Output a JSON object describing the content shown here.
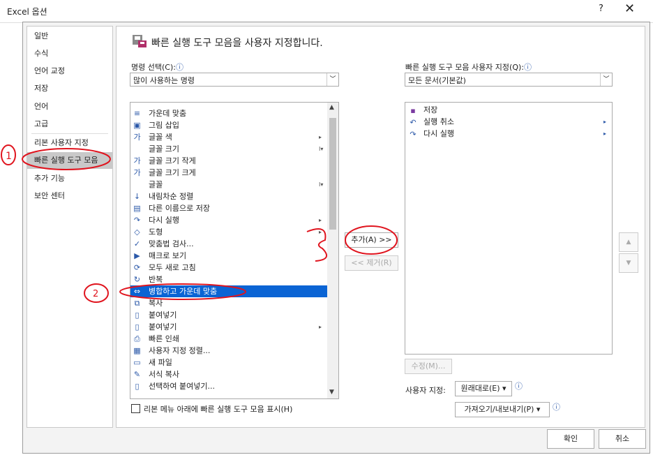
{
  "window": {
    "title": "Excel 옵션",
    "help": "?",
    "close": "✕"
  },
  "nav": {
    "items": [
      "일반",
      "수식",
      "언어 교정",
      "저장",
      "언어",
      "고급",
      "리본 사용자 지정",
      "빠른 실행 도구 모음",
      "추가 기능",
      "보안 센터"
    ],
    "selected_index": 7
  },
  "main": {
    "headline": "빠른 실행 도구 모음을 사용자 지정합니다.",
    "choose_label": "명령 선택(C):",
    "choose_value": "많이 사용하는 명령",
    "customize_label": "빠른 실행 도구 모음 사용자 지정(Q):",
    "customize_value": "모든 문서(기본값)",
    "info_icon": "ⓘ",
    "commands": [
      {
        "label": "가운데 맞춤",
        "icon": "align-center-icon",
        "glyph": "≡",
        "sub": ""
      },
      {
        "label": "그림 삽입",
        "icon": "picture-icon",
        "glyph": "▣",
        "sub": ""
      },
      {
        "label": "글꼴 색",
        "icon": "font-color-icon",
        "glyph": "가",
        "sub": "▸"
      },
      {
        "label": "글꼴 크기",
        "icon": "font-size-icon",
        "glyph": "",
        "sub": "I▾"
      },
      {
        "label": "글꼴 크기 작게",
        "icon": "font-shrink-icon",
        "glyph": "가",
        "sub": ""
      },
      {
        "label": "글꼴 크기 크게",
        "icon": "font-grow-icon",
        "glyph": "가",
        "sub": ""
      },
      {
        "label": "글꼴",
        "icon": "font-icon",
        "glyph": "",
        "sub": "I▾"
      },
      {
        "label": "내림차순 정렬",
        "icon": "sort-desc-icon",
        "glyph": "↓",
        "sub": ""
      },
      {
        "label": "다른 이름으로 저장",
        "icon": "save-as-icon",
        "glyph": "▤",
        "sub": ""
      },
      {
        "label": "다시 실행",
        "icon": "redo-icon",
        "glyph": "↷",
        "sub": "▸"
      },
      {
        "label": "도형",
        "icon": "shapes-icon",
        "glyph": "◇",
        "sub": "▸"
      },
      {
        "label": "맞춤법 검사...",
        "icon": "spellcheck-icon",
        "glyph": "✓",
        "sub": ""
      },
      {
        "label": "매크로 보기",
        "icon": "macro-icon",
        "glyph": "▶",
        "sub": ""
      },
      {
        "label": "모두 새로 고침",
        "icon": "refresh-all-icon",
        "glyph": "⟳",
        "sub": ""
      },
      {
        "label": "반복",
        "icon": "repeat-icon",
        "glyph": "↻",
        "sub": ""
      },
      {
        "label": "병합하고 가운데 맞춤",
        "icon": "merge-center-icon",
        "glyph": "⇔",
        "sub": ""
      },
      {
        "label": "복사",
        "icon": "copy-icon",
        "glyph": "⧉",
        "sub": ""
      },
      {
        "label": "붙여넣기",
        "icon": "paste-icon",
        "glyph": "▯",
        "sub": ""
      },
      {
        "label": "붙여넣기",
        "icon": "paste-icon",
        "glyph": "▯",
        "sub": "▸"
      },
      {
        "label": "빠른 인쇄",
        "icon": "quick-print-icon",
        "glyph": "⎙",
        "sub": ""
      },
      {
        "label": "사용자 지정 정렬...",
        "icon": "custom-sort-icon",
        "glyph": "▦",
        "sub": ""
      },
      {
        "label": "새 파일",
        "icon": "new-file-icon",
        "glyph": "▭",
        "sub": ""
      },
      {
        "label": "서식 복사",
        "icon": "format-painter-icon",
        "glyph": "✎",
        "sub": ""
      },
      {
        "label": "선택하여 붙여넣기...",
        "icon": "paste-special-icon",
        "glyph": "▯",
        "sub": ""
      }
    ],
    "selected_command_index": 15,
    "qat_items": [
      {
        "label": "저장",
        "icon": "save-icon",
        "glyph": "▪",
        "sub": ""
      },
      {
        "label": "실행 취소",
        "icon": "undo-icon",
        "glyph": "↶",
        "sub": "▸"
      },
      {
        "label": "다시 실행",
        "icon": "redo-icon",
        "glyph": "↷",
        "sub": "▸"
      }
    ],
    "add_button": "추가(A) >>",
    "remove_button": "<< 제거(R)",
    "modify_button": "수정(M)...",
    "user_settings_label": "사용자 지정:",
    "reset_button": "원래대로(E) ▾",
    "import_export_button": "가져오기/내보내기(P) ▾",
    "checkbox_label": "리본 메뉴 아래에 빠른 실행 도구 모음 표시(H)",
    "move_up": "▲",
    "move_down": "▼"
  },
  "footer": {
    "ok": "확인",
    "cancel": "취소"
  },
  "annotations": {
    "mark1": "1",
    "mark2": "2",
    "mark3": "3"
  }
}
